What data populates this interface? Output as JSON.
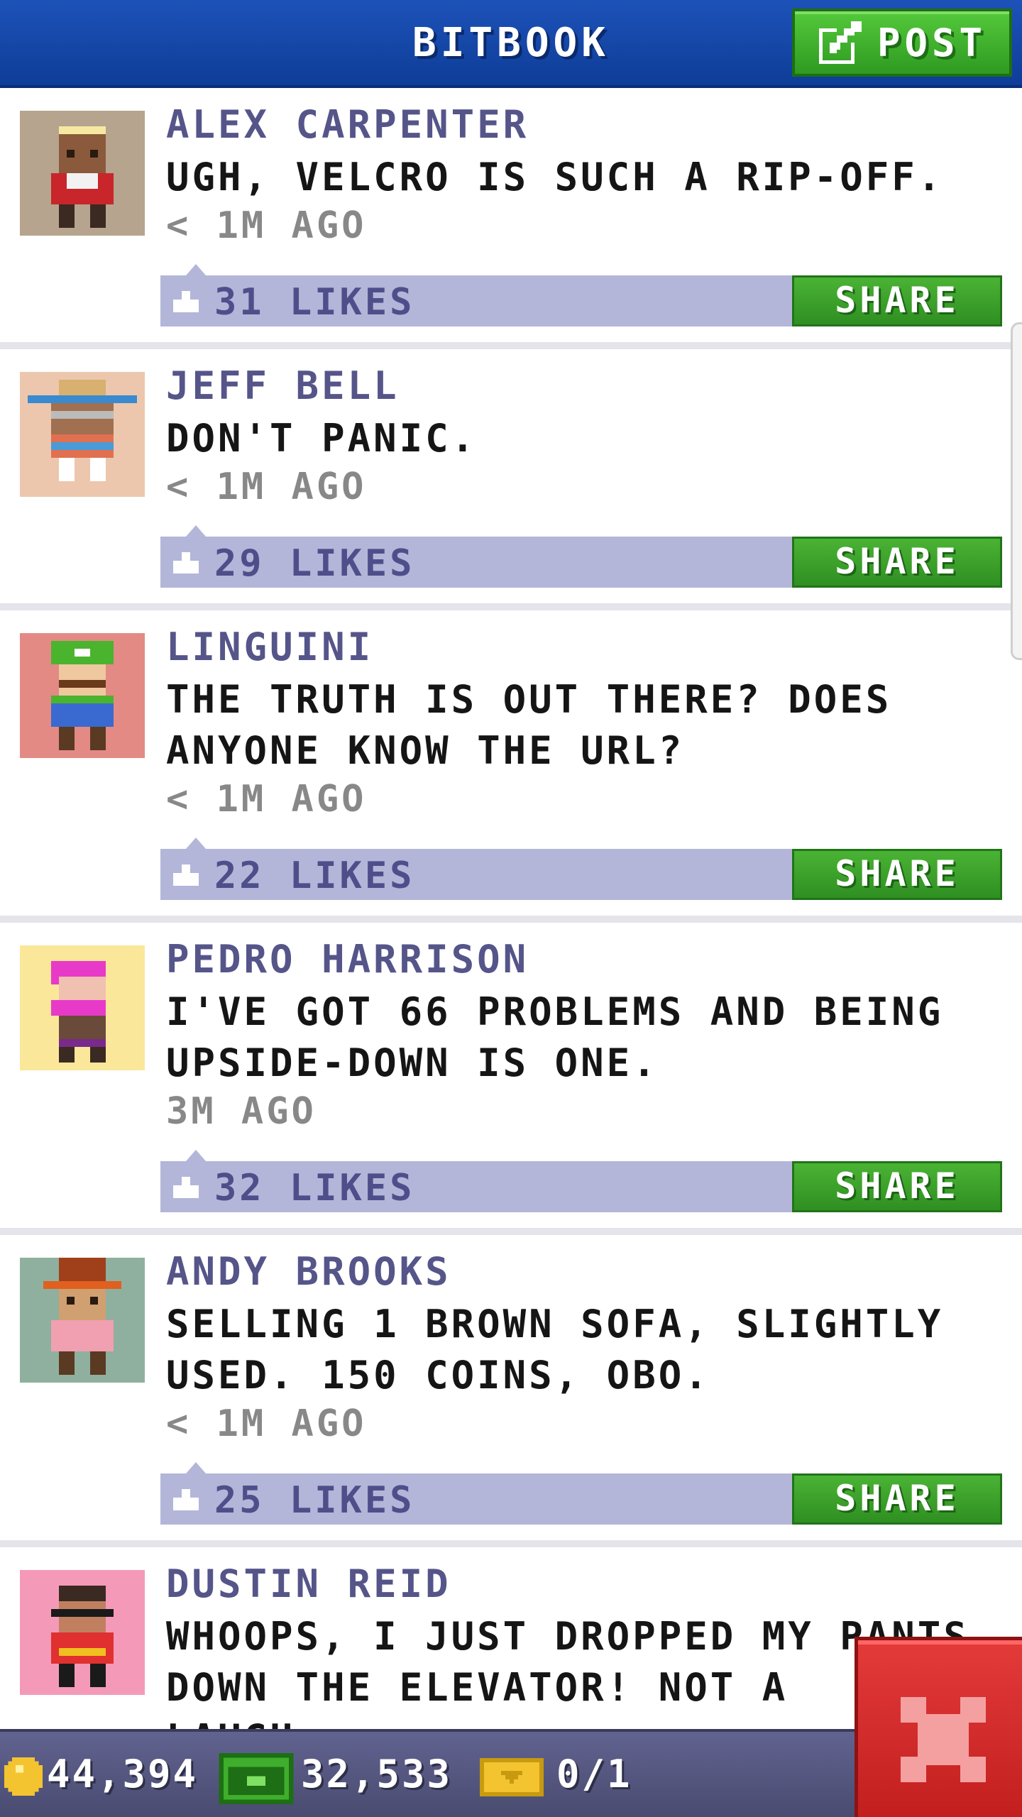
{
  "header": {
    "title": "BITBOOK",
    "post_label": "POST"
  },
  "posts": [
    {
      "author": "ALEX CARPENTER",
      "message": "UGH, VELCRO IS SUCH A RIP-OFF.",
      "time": "< 1M AGO",
      "likes": "31 LIKES",
      "share_label": "SHARE",
      "avatar_bg": "#b6a48e"
    },
    {
      "author": "JEFF BELL",
      "message": "DON'T PANIC.",
      "time": "< 1M AGO",
      "likes": "29 LIKES",
      "share_label": "SHARE",
      "avatar_bg": "#ecc7ad"
    },
    {
      "author": "LINGUINI",
      "message": "THE TRUTH IS OUT THERE? DOES ANYONE KNOW THE URL?",
      "time": "< 1M AGO",
      "likes": "22 LIKES",
      "share_label": "SHARE",
      "avatar_bg": "#e38a84"
    },
    {
      "author": "PEDRO HARRISON",
      "message": "I'VE GOT 66 PROBLEMS AND BEING UPSIDE-DOWN IS ONE.",
      "time": "3M AGO",
      "likes": "32 LIKES",
      "share_label": "SHARE",
      "avatar_bg": "#fbe79a"
    },
    {
      "author": "ANDY BROOKS",
      "message": "SELLING 1 BROWN SOFA, SLIGHTLY USED. 150 COINS, OBO.",
      "time": "< 1M AGO",
      "likes": "25 LIKES",
      "share_label": "SHARE",
      "avatar_bg": "#8fb09e"
    },
    {
      "author": "DUSTIN REID",
      "message": "WHOOPS, I JUST DROPPED MY PANTS DOWN THE ELEVATOR! NOT A LAUGH...",
      "avatar_bg": "#f49ab8"
    }
  ],
  "status": {
    "coins": "44,394",
    "bux": "32,533",
    "tickets": "0/1"
  },
  "colors": {
    "header_blue": "#1d52b8",
    "post_green": "#3fae2c",
    "likes_bar": "#b3b6d8",
    "author_purple": "#55558a",
    "close_red": "#d42a2a"
  },
  "icons": [
    "edit-icon",
    "like-icon",
    "coin-icon",
    "bux-icon",
    "ticket-icon",
    "close-icon"
  ]
}
